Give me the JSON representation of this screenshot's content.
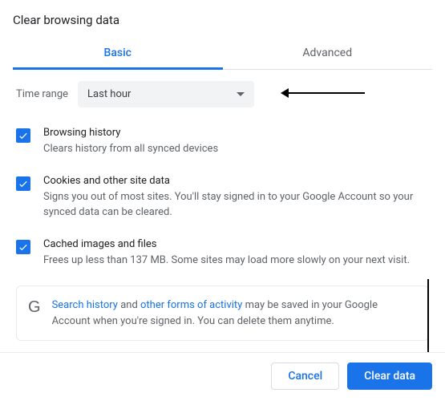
{
  "dialog": {
    "title": "Clear browsing data"
  },
  "tabs": {
    "basic": "Basic",
    "advanced": "Advanced"
  },
  "timeRange": {
    "label": "Time range",
    "value": "Last hour"
  },
  "options": {
    "browsing": {
      "title": "Browsing history",
      "desc": "Clears history from all synced devices"
    },
    "cookies": {
      "title": "Cookies and other site data",
      "desc": "Signs you out of most sites. You'll stay signed in to your Google Account so your synced data can be cleared."
    },
    "cache": {
      "title": "Cached images and files",
      "desc": "Frees up less than 137 MB. Some sites may load more slowly on your next visit."
    }
  },
  "info": {
    "link1": "Search history",
    "mid1": " and ",
    "link2": "other forms of activity",
    "rest": " may be saved in your Google Account when you're signed in. You can delete them anytime."
  },
  "buttons": {
    "cancel": "Cancel",
    "clear": "Clear data"
  }
}
